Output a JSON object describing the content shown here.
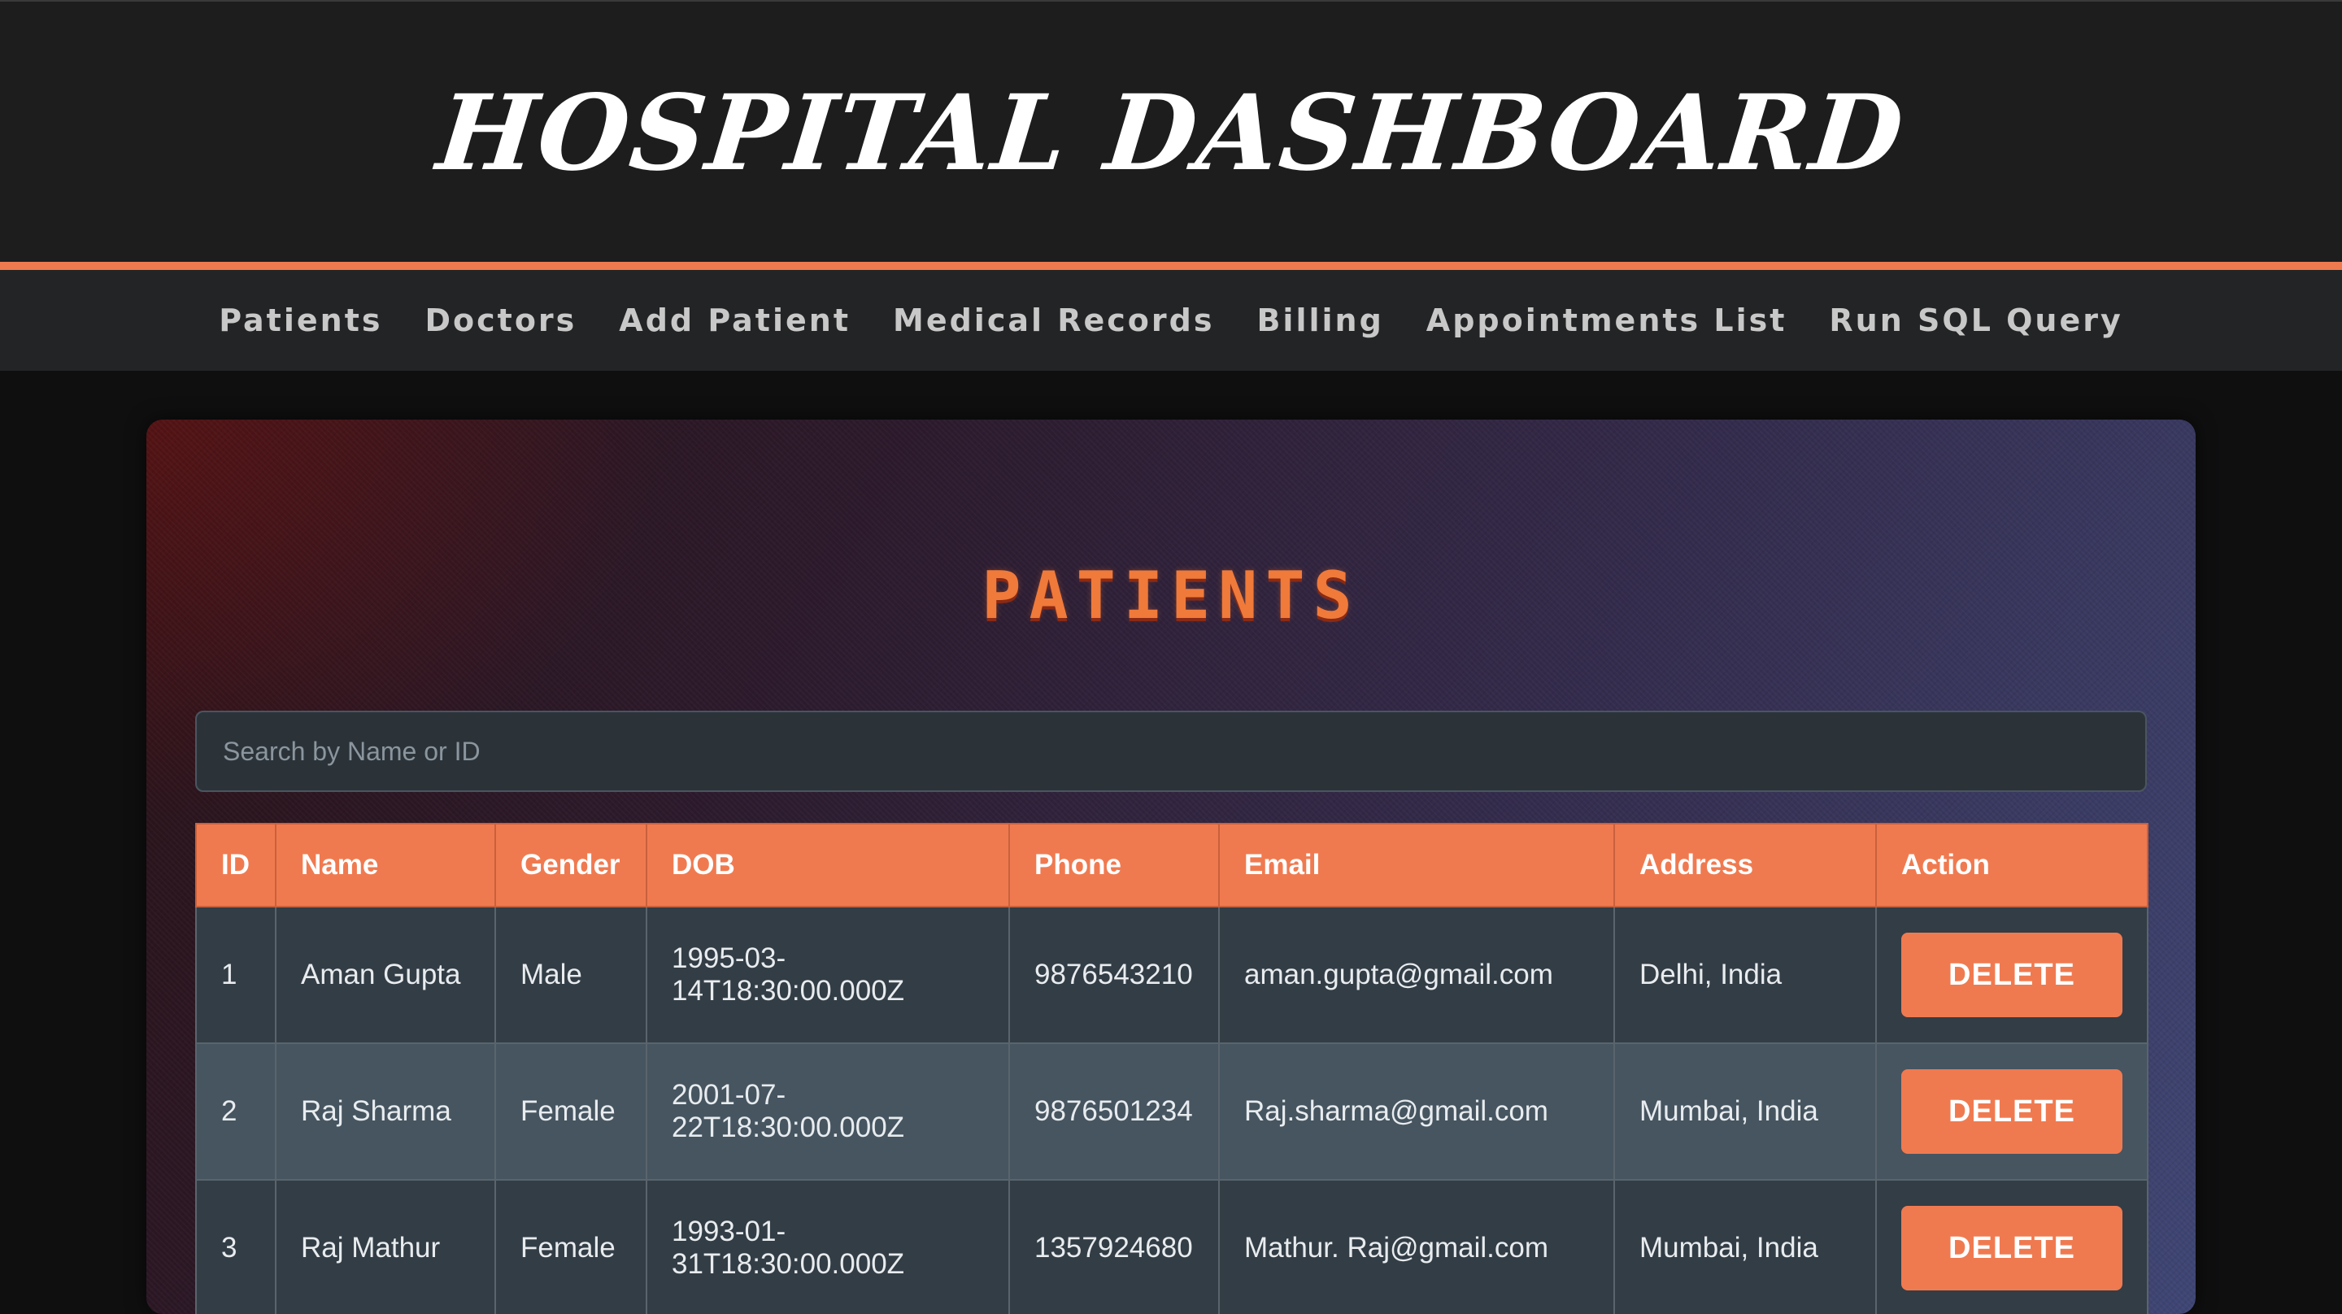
{
  "header": {
    "title": "HOSPITAL DASHBOARD"
  },
  "nav": {
    "items": [
      "Patients",
      "Doctors",
      "Add Patient",
      "Medical Records",
      "Billing",
      "Appointments List",
      "Run SQL Query"
    ]
  },
  "main": {
    "title": "PATIENTS",
    "search_placeholder": "Search by Name or ID",
    "columns": [
      "ID",
      "Name",
      "Gender",
      "DOB",
      "Phone",
      "Email",
      "Address",
      "Action"
    ],
    "rows": [
      {
        "id": "1",
        "name": "Aman Gupta",
        "gender": "Male",
        "dob_line1": "1995-03-",
        "dob_line2": "14T18:30:00.000Z",
        "phone": "9876543210",
        "email": "aman.gupta@gmail.com",
        "address": "Delhi, India",
        "action": "DELETE"
      },
      {
        "id": "2",
        "name": "Raj Sharma",
        "gender": "Female",
        "dob_line1": "2001-07-",
        "dob_line2": "22T18:30:00.000Z",
        "phone": "9876501234",
        "email": "Raj.sharma@gmail.com",
        "address": "Mumbai, India",
        "action": "DELETE"
      },
      {
        "id": "3",
        "name": "Raj Mathur",
        "gender": "Female",
        "dob_line1": "1993-01-",
        "dob_line2": "31T18:30:00.000Z",
        "phone": "1357924680",
        "email": "Mathur. Raj@gmail.com",
        "address": "Mumbai, India",
        "action": "DELETE"
      }
    ]
  },
  "colors": {
    "accent": "#f07a50",
    "header_bg": "#1d1d1e",
    "nav_bg": "#232425",
    "row_odd": "#333d45",
    "row_even": "#465560"
  }
}
